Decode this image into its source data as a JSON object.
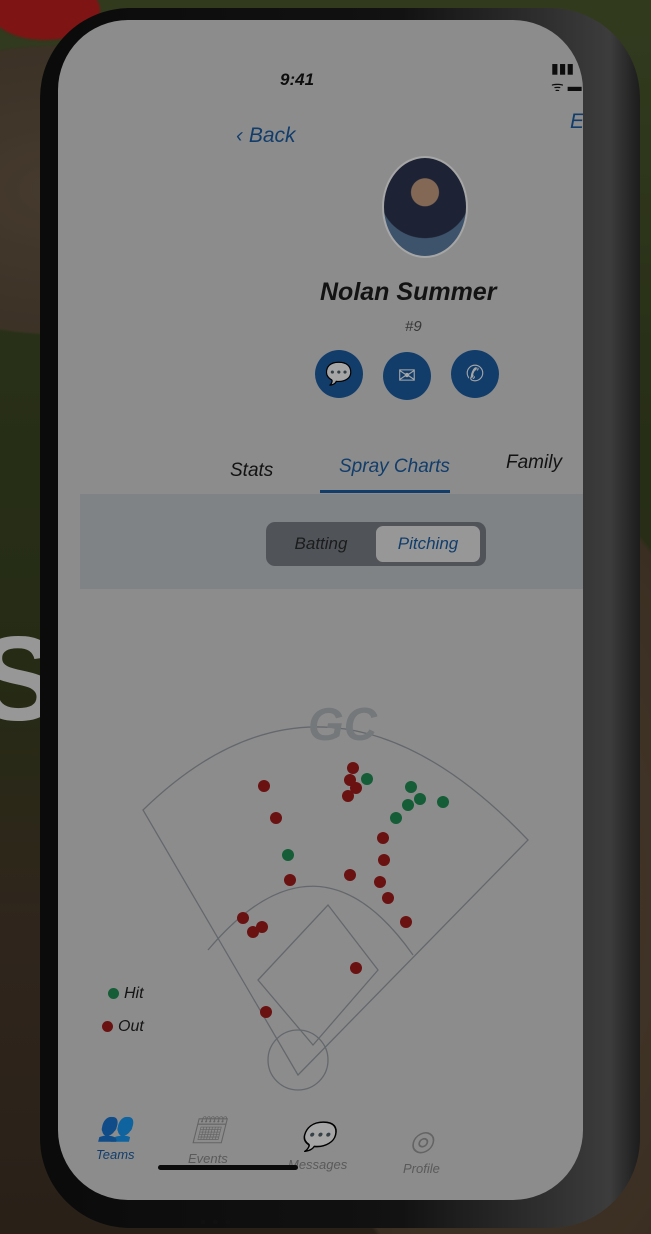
{
  "status": {
    "time": "9:41",
    "signal": "▮▮▮ ᯤ ▬"
  },
  "nav": {
    "back": "Back",
    "edit": "Edit"
  },
  "player": {
    "name": "Nolan Summer",
    "number": "#9"
  },
  "actions": [
    "chat-icon",
    "mail-icon",
    "phone-icon"
  ],
  "tabs": [
    {
      "label": "Stats"
    },
    {
      "label": "Spray Charts",
      "active": true
    },
    {
      "label": "Family"
    }
  ],
  "segment": {
    "left": "Batting",
    "right": "Pitching",
    "selected": "Pitching"
  },
  "spray_chart": {
    "logo": "GC",
    "legend": [
      {
        "label": "Hit",
        "color": "#1f8f55"
      },
      {
        "label": "Out",
        "color": "#a31c1c"
      }
    ]
  },
  "tabbar": [
    {
      "label": "Teams",
      "icon": "teams-icon",
      "active": true
    },
    {
      "label": "Events",
      "icon": "calendar-icon"
    },
    {
      "label": "Messages",
      "icon": "message-icon"
    },
    {
      "label": "Profile",
      "icon": "profile-icon"
    }
  ],
  "colors": {
    "accent": "#1c5fa5",
    "hit": "#1f8f55",
    "out": "#a31c1c"
  }
}
